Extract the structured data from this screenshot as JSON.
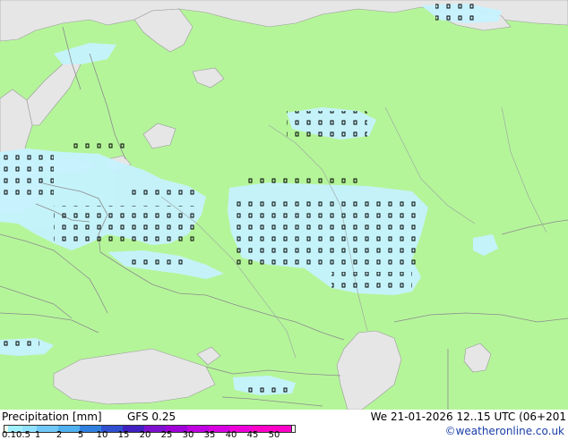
{
  "legend": {
    "title": "Precipitation [mm]",
    "model": "GFS 0.25",
    "scale_labels": [
      "0.1",
      "0.5",
      "1",
      "2",
      "5",
      "10",
      "15",
      "20",
      "25",
      "30",
      "35",
      "40",
      "45",
      "50"
    ],
    "scale_colors": [
      "#ecffec",
      "#a0f0ff",
      "#90e0ff",
      "#70c8f8",
      "#50b0f0",
      "#3080e0",
      "#3050d0",
      "#4020c0",
      "#8010d0",
      "#a000d8",
      "#c000e0",
      "#d800e0",
      "#ee00d8",
      "#ff00c8"
    ]
  },
  "valid_time": "We 21-01-2026 12..15 UTC (06+201",
  "credit": "©weatheronline.co.uk",
  "map": {
    "land_color": "#b5f59a",
    "sea_color": "#e6e6e6",
    "precip_color": "#c6f2ff",
    "border_color": "#8c8c8c"
  }
}
